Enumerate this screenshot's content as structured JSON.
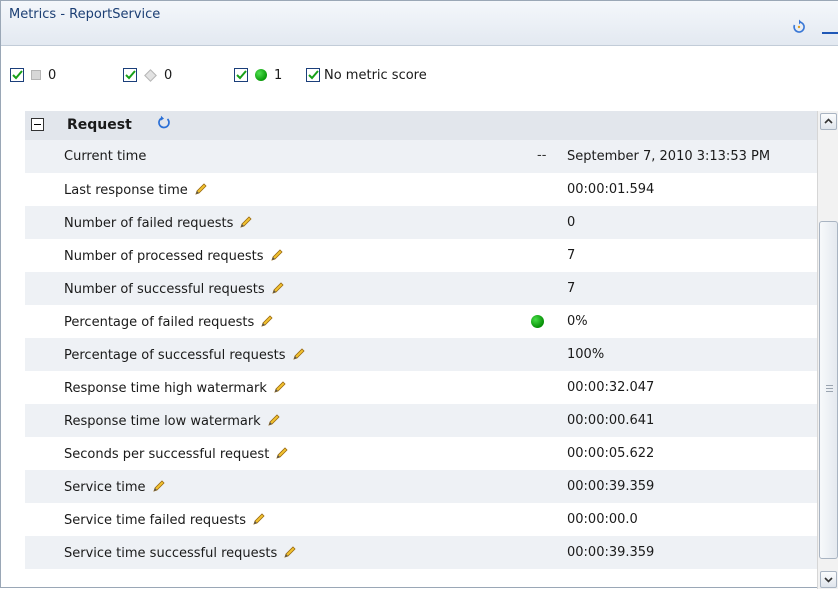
{
  "window": {
    "title": "Metrics - ReportService"
  },
  "filters": [
    {
      "label": "0",
      "icon": "gray-square-icon",
      "checked": true
    },
    {
      "label": "0",
      "icon": "gray-diamond-icon",
      "checked": true
    },
    {
      "label": "1",
      "icon": "green-ball-icon",
      "checked": true
    },
    {
      "label": "No metric score",
      "checked": true
    }
  ],
  "group": {
    "label": "Request",
    "expanded": true
  },
  "rows": [
    {
      "name": "Current time",
      "indicator": "--",
      "value": "September 7, 2010 3:13:53 PM"
    },
    {
      "name": "Last response time",
      "value": "00:00:01.594"
    },
    {
      "name": "Number of failed requests",
      "value": "0"
    },
    {
      "name": "Number of processed requests",
      "value": "7"
    },
    {
      "name": "Number of successful requests",
      "value": "7"
    },
    {
      "name": "Percentage of failed requests",
      "value": "0%",
      "status": "green"
    },
    {
      "name": "Percentage of successful requests",
      "value": "100%"
    },
    {
      "name": "Response time high watermark",
      "value": "00:00:32.047"
    },
    {
      "name": "Response time low watermark",
      "value": "00:00:00.641"
    },
    {
      "name": "Seconds per successful request",
      "value": "00:00:05.622"
    },
    {
      "name": "Service time",
      "value": "00:00:39.359"
    },
    {
      "name": "Service time failed requests",
      "value": "00:00:00.0"
    },
    {
      "name": "Service time successful requests",
      "value": "00:00:39.359"
    }
  ],
  "colors": {
    "accent": "#1f58b6",
    "title_text": "#1c3f74",
    "status_green": "#0a9a0a",
    "group_bg": "#e2e6ec"
  }
}
